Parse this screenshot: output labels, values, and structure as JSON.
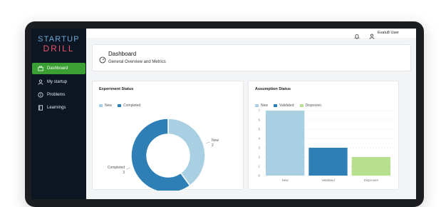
{
  "brand": {
    "line1": "STARTUP",
    "line2": "DRILL"
  },
  "sidebar": {
    "items": [
      {
        "label": "Dashboard",
        "icon": "dashboard-icon",
        "active": true
      },
      {
        "label": "My startup",
        "icon": "user-icon",
        "active": false
      },
      {
        "label": "Problems",
        "icon": "info-icon",
        "active": false
      },
      {
        "label": "Learnings",
        "icon": "notebook-icon",
        "active": false
      }
    ]
  },
  "topbar": {
    "user": "Evalu8 User",
    "icons": [
      "bell-icon",
      "user-icon"
    ]
  },
  "header": {
    "title": "Dashboard",
    "subtitle": "General Overview and Metrics",
    "icon": "gauge-icon"
  },
  "colors": {
    "sidebar_bg": "#0c1723",
    "active_nav": "#3aa033",
    "new": "#a9d0e2",
    "completed": "#2f7fb7",
    "validated": "#2f7fb7",
    "disproven": "#b6e08e"
  },
  "chart_data": [
    {
      "type": "pie",
      "title": "Experiment Status",
      "legend": [
        "New",
        "Completed"
      ],
      "slices": [
        {
          "label": "New",
          "value": 2
        },
        {
          "label": "Completed",
          "value": 3
        }
      ]
    },
    {
      "type": "bar",
      "title": "Assumption Status",
      "legend": [
        "New",
        "Validated",
        "Disproven"
      ],
      "categories": [
        "New",
        "Validated",
        "Disproven"
      ],
      "values": [
        7,
        3,
        2
      ],
      "ylim": [
        0,
        7
      ],
      "yticks": [
        0,
        1,
        2,
        3,
        4,
        5,
        6,
        7
      ],
      "grid": true
    }
  ]
}
